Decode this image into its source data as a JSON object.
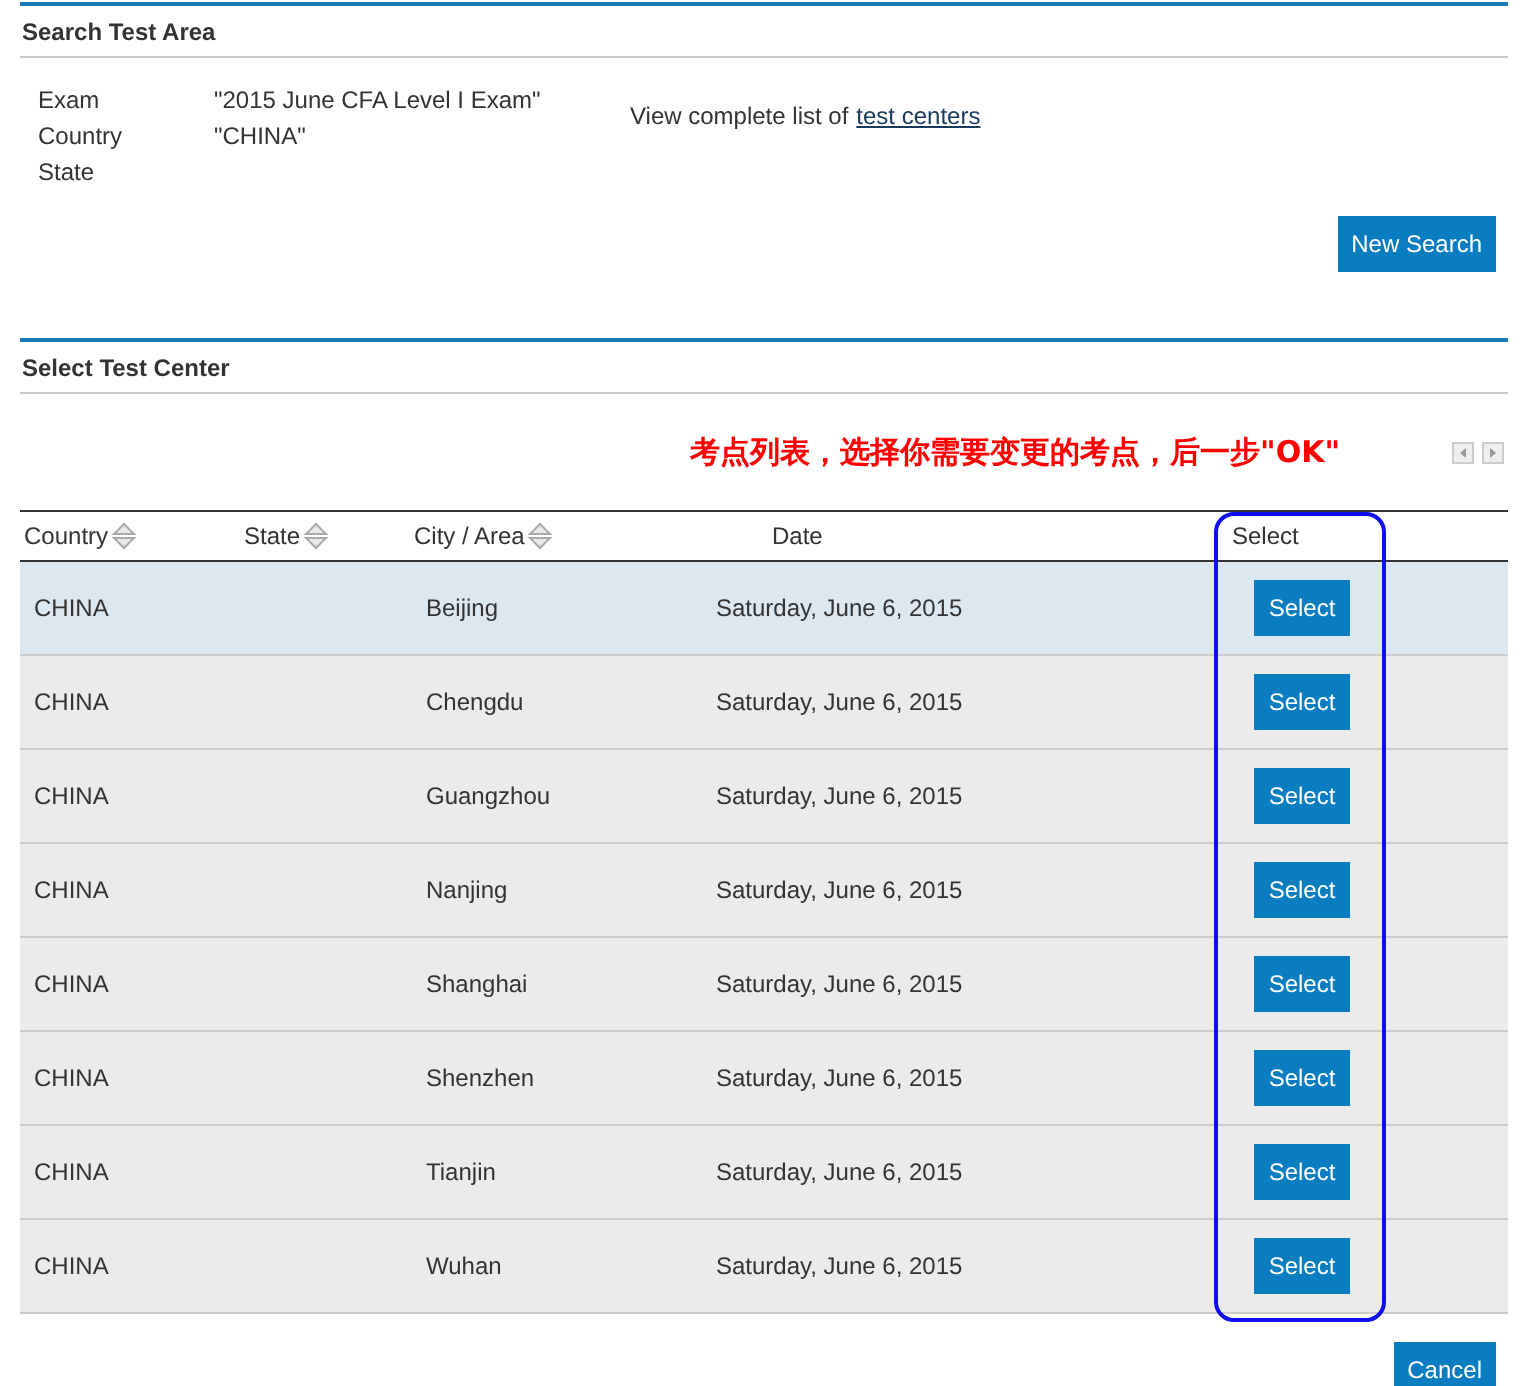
{
  "search_section": {
    "title": "Search Test Area",
    "fields": [
      {
        "label": "Exam",
        "value": "\"2015 June CFA Level I Exam\""
      },
      {
        "label": "Country",
        "value": "\"CHINA\""
      },
      {
        "label": "State"
      }
    ],
    "link_prefix": "View complete list of",
    "link": "test centers",
    "button": "New Search"
  },
  "select_section": {
    "title": "Select Test Center",
    "annotation": "考点列表，选择你需要变更的考点，后一步\"OK\"",
    "columns": [
      {
        "label": "Country",
        "sortable": true
      },
      {
        "label": "State",
        "sortable": true
      },
      {
        "label": "City / Area",
        "sortable": true
      },
      {
        "label": "Date",
        "sortable": false
      },
      {
        "label": "Select",
        "sortable": false
      }
    ],
    "rows": [
      {
        "country": "CHINA",
        "city": "Beijing",
        "date": "Saturday, June 6, 2015",
        "button": "Select",
        "selected": true
      },
      {
        "country": "CHINA",
        "city": "Chengdu",
        "date": "Saturday, June 6, 2015",
        "button": "Select",
        "selected": false
      },
      {
        "country": "CHINA",
        "city": "Guangzhou",
        "date": "Saturday, June 6, 2015",
        "button": "Select",
        "selected": false
      },
      {
        "country": "CHINA",
        "city": "Nanjing",
        "date": "Saturday, June 6, 2015",
        "button": "Select",
        "selected": false
      },
      {
        "country": "CHINA",
        "city": "Shanghai",
        "date": "Saturday, June 6, 2015",
        "button": "Select",
        "selected": false
      },
      {
        "country": "CHINA",
        "city": "Shenzhen",
        "date": "Saturday, June 6, 2015",
        "button": "Select",
        "selected": false
      },
      {
        "country": "CHINA",
        "city": "Tianjin",
        "date": "Saturday, June 6, 2015",
        "button": "Select",
        "selected": false
      },
      {
        "country": "CHINA",
        "city": "Wuhan",
        "date": "Saturday, June 6, 2015",
        "button": "Select",
        "selected": false
      }
    ],
    "cancel": "Cancel"
  }
}
